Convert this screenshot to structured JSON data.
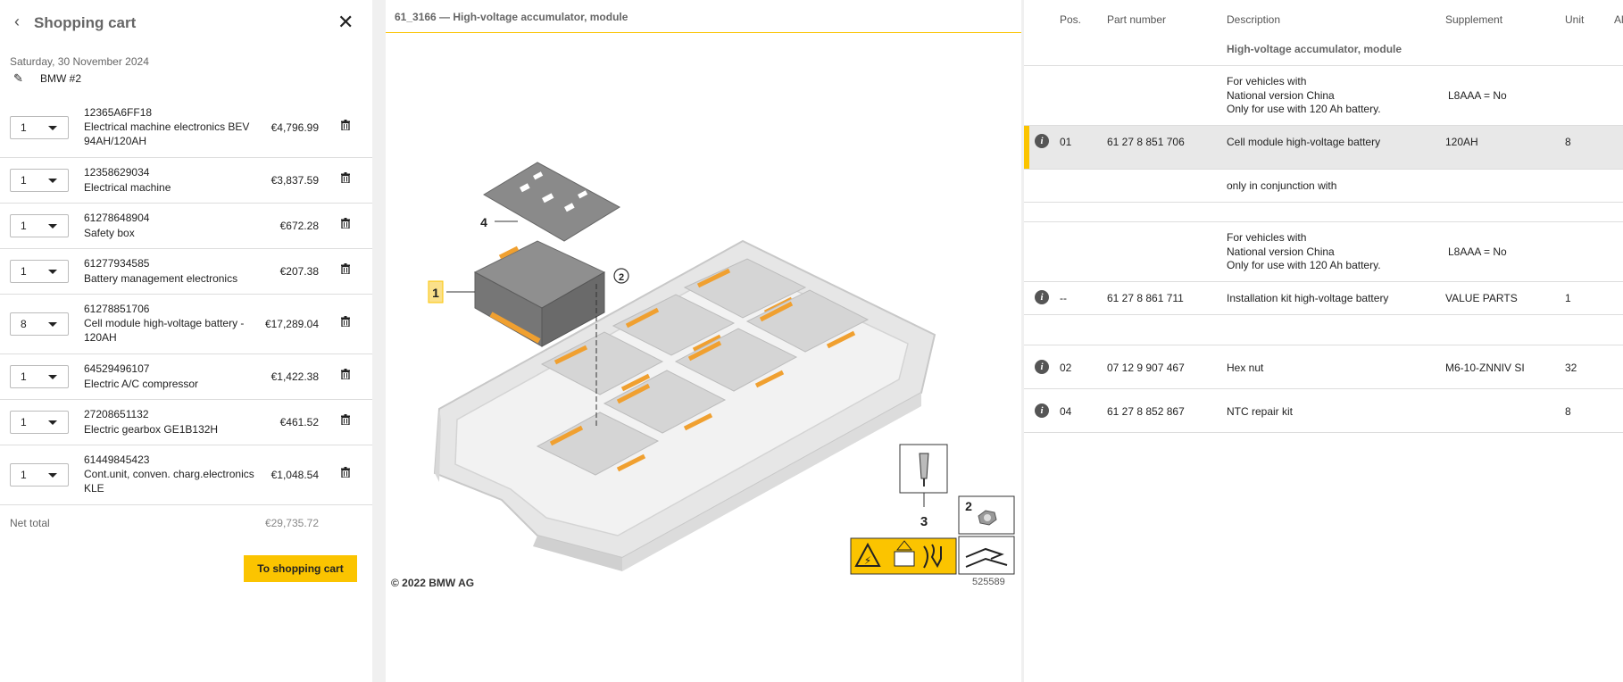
{
  "cart": {
    "back_icon": "chevron-left-icon",
    "title": "Shopping cart",
    "close_icon": "close-icon",
    "date": "Saturday, 30 November 2024",
    "name": "BMW #2",
    "items": [
      {
        "qty": "1",
        "part_number": "12365A6FF18",
        "description": "Electrical machine electronics BEV 94AH/120AH",
        "price": "€4,796.99"
      },
      {
        "qty": "1",
        "part_number": "12358629034",
        "description": "Electrical machine",
        "price": "€3,837.59"
      },
      {
        "qty": "1",
        "part_number": "61278648904",
        "description": "Safety box",
        "price": "€672.28"
      },
      {
        "qty": "1",
        "part_number": "61277934585",
        "description": "Battery management electronics",
        "price": "€207.38"
      },
      {
        "qty": "8",
        "part_number": "61278851706",
        "description": "Cell module high-voltage battery - 120AH",
        "price": "€17,289.04"
      },
      {
        "qty": "1",
        "part_number": "64529496107",
        "description": "Electric A/C compressor",
        "price": "€1,422.38"
      },
      {
        "qty": "1",
        "part_number": "27208651132",
        "description": "Electric gearbox GE1B132H",
        "price": "€461.52"
      },
      {
        "qty": "1",
        "part_number": "61449845423",
        "description": "Cont.unit, conven. charg.electronics KLE",
        "price": "€1,048.54"
      }
    ],
    "net_total_label": "Net total",
    "net_total_value": "€29,735.72",
    "to_cart_button": "To shopping cart"
  },
  "diagram": {
    "title": "61_3166 — High-voltage accumulator, module",
    "copyright": "© 2022 BMW AG",
    "image_number": "525589",
    "callouts": [
      "1",
      "2",
      "3",
      "4"
    ]
  },
  "table": {
    "headers": {
      "pos": "Pos.",
      "part_number": "Part number",
      "description": "Description",
      "supplement": "Supplement",
      "unit": "Unit",
      "extra": "Al"
    },
    "group_title": "High-voltage accumulator, module",
    "note1": {
      "line1": "For vehicles with",
      "line2": "National version China",
      "line3": "Only for use with 120 Ah battery.",
      "supplement": "L8AAA = No"
    },
    "rows": [
      {
        "pos": "01",
        "part_number": "61 27 8 851 706",
        "description": "Cell module high-voltage battery",
        "supplement": "120AH",
        "unit": "8"
      },
      {
        "pos": "--",
        "part_number": "61 27 8 861 711",
        "description": "Installation kit high-voltage battery",
        "supplement": "VALUE PARTS",
        "unit": "1"
      },
      {
        "pos": "02",
        "part_number": "07 12 9 907 467",
        "description": "Hex nut",
        "supplement": "M6-10-ZNNIV SI",
        "unit": "32"
      },
      {
        "pos": "04",
        "part_number": "61 27 8 852 867",
        "description": "NTC repair kit",
        "supplement": "",
        "unit": "8"
      }
    ],
    "conjunction": "only in conjunction with",
    "note2": {
      "line1": "For vehicles with",
      "line2": "National version China",
      "line3": "Only for use with 120 Ah battery.",
      "supplement": "L8AAA = No"
    },
    "info_icon": "info-icon"
  },
  "colors": {
    "accent": "#fbc400"
  }
}
